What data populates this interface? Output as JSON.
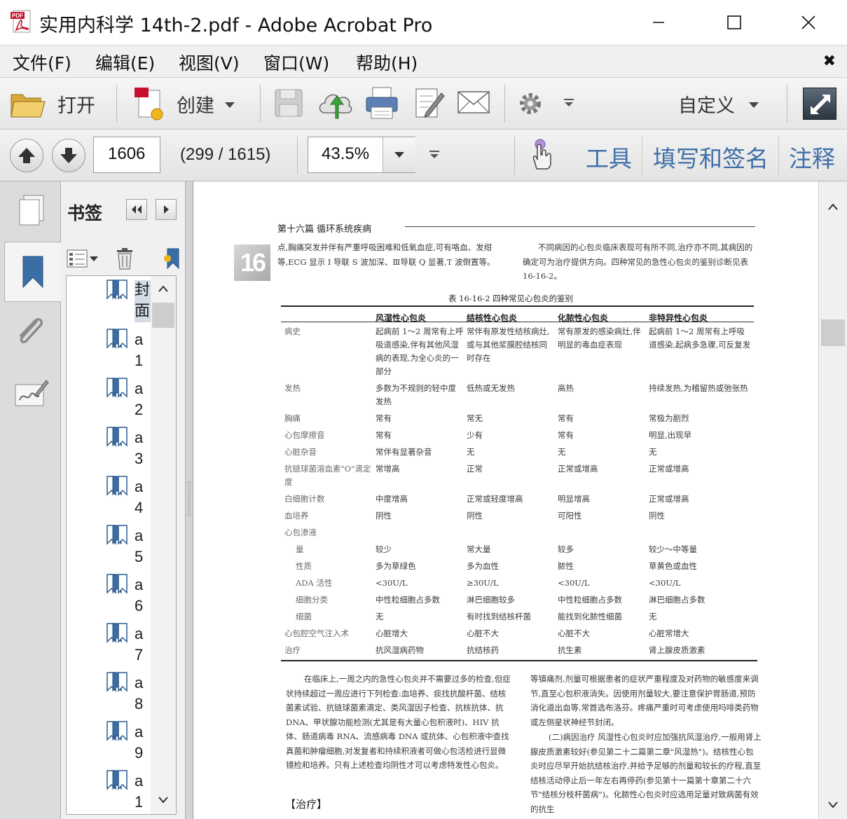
{
  "window": {
    "title": "实用内科学 14th-2.pdf - Adobe Acrobat Pro",
    "app_icon": "pdf-file-icon",
    "controls": [
      "minimize-icon",
      "maximize-icon",
      "close-icon"
    ]
  },
  "menu": {
    "items": [
      "文件(F)",
      "编辑(E)",
      "视图(V)",
      "窗口(W)",
      "帮助(H)"
    ],
    "close_glyph": "✖"
  },
  "toolbar": {
    "open_label": "打开",
    "create_label": "创建",
    "customize_label": "自定义"
  },
  "nav": {
    "page_number": "1606",
    "page_count": "(299 / 1615)",
    "zoom": "43.5%",
    "tabs": [
      "工具",
      "填写和签名",
      "注释"
    ]
  },
  "sidebar": {
    "title": "书签",
    "bookmarks": [
      {
        "label": "封面",
        "selected": true
      },
      {
        "label": "a1",
        "selected": false
      },
      {
        "label": "a2",
        "selected": false
      },
      {
        "label": "a3",
        "selected": false
      },
      {
        "label": "a4",
        "selected": false
      },
      {
        "label": "a5",
        "selected": false
      },
      {
        "label": "a6",
        "selected": false
      },
      {
        "label": "a7",
        "selected": false
      },
      {
        "label": "a8",
        "selected": false
      },
      {
        "label": "a9",
        "selected": false
      },
      {
        "label": "a1",
        "selected": false
      }
    ]
  },
  "document": {
    "header": "第十六篇    循环系统疾病",
    "chapter_badge": "16",
    "intro_left": "点,胸痛突发并伴有严重呼吸困难和低氧血症,可有咯血、发绀等,ECG 显示 I 导联 S 波加深、Ⅲ导联 Q 显著,T 波倒置等。",
    "intro_right": "不同病因的心包炎临床表现可有所不同,治疗亦不同,其病因的确定可为治疗提供方向。四种常见的急性心包炎的鉴别诊断见表 16-16-2。",
    "table_caption": "表 16-16-2    四种常见心包炎的鉴别",
    "table_headers": [
      "",
      "风湿性心包炎",
      "结核性心包炎",
      "化脓性心包炎",
      "非特异性心包炎"
    ],
    "table_rows": [
      {
        "sub": false,
        "cells": [
          "病史",
          "起病前 1～2 周常有上呼吸道感染,伴有其他风湿病的表现,为全心炎的一部分",
          "常伴有原发性结核病灶,或与其他浆膜腔结核同时存在",
          "常有原发的感染病灶,伴明显的毒血症表现",
          "起病前 1～2 周常有上呼吸道感染,起病多急骤,可反复发"
        ]
      },
      {
        "sub": false,
        "cells": [
          "发热",
          "多数为不规则的轻中度发热",
          "低热或无发热",
          "高热",
          "持续发热,为稽留热或弛张热"
        ]
      },
      {
        "sub": false,
        "cells": [
          "胸痛",
          "常有",
          "常无",
          "常有",
          "常极为剧烈"
        ]
      },
      {
        "sub": false,
        "cells": [
          "心包摩擦音",
          "常有",
          "少有",
          "常有",
          "明显,出现早"
        ]
      },
      {
        "sub": false,
        "cells": [
          "心脏杂音",
          "常伴有显著杂音",
          "无",
          "无",
          "无"
        ]
      },
      {
        "sub": false,
        "cells": [
          "抗链球菌溶血素\"O\"滴定度",
          "常增高",
          "正常",
          "正常或增高",
          "正常或增高"
        ]
      },
      {
        "sub": false,
        "cells": [
          "白细胞计数",
          "中度增高",
          "正常或轻度增高",
          "明显增高",
          "正常或增高"
        ]
      },
      {
        "sub": false,
        "cells": [
          "血培养",
          "阴性",
          "阴性",
          "可阳性",
          "阴性"
        ]
      },
      {
        "sub": false,
        "cells": [
          "心包渗液",
          "",
          "",
          "",
          ""
        ]
      },
      {
        "sub": true,
        "cells": [
          "量",
          "较少",
          "常大量",
          "较多",
          "较少～中等量"
        ]
      },
      {
        "sub": true,
        "cells": [
          "性质",
          "多为草绿色",
          "多为血性",
          "脓性",
          "草黄色或血性"
        ]
      },
      {
        "sub": true,
        "cells": [
          "ADA 活性",
          "<30U/L",
          "≥30U/L",
          "<30U/L",
          "<30U/L"
        ]
      },
      {
        "sub": true,
        "cells": [
          "细胞分类",
          "中性粒细胞占多数",
          "淋巴细胞较多",
          "中性粒细胞占多数",
          "淋巴细胞占多数"
        ]
      },
      {
        "sub": true,
        "cells": [
          "细菌",
          "无",
          "有时找到结核杆菌",
          "能找到化脓性细菌",
          "无"
        ]
      },
      {
        "sub": false,
        "cells": [
          "心包腔空气注入术",
          "心脏增大",
          "心脏不大",
          "心脏不大",
          "心脏常增大"
        ]
      },
      {
        "sub": false,
        "cells": [
          "治疗",
          "抗风湿病药物",
          "抗结核药",
          "抗生素",
          "肾上腺皮质激素"
        ]
      }
    ],
    "bottom_left": "在临床上,一周之内的急性心包炎并不需要过多的检查,但症状持续超过一周应进行下列检查:血培养、痰找抗酸杆菌、结核菌素试验、抗链球菌素滴定、类风湿因子检查、抗核抗体、抗 DNA、甲状腺功能检测(尤其是有大量心包积液时)、HIV 抗体、肠道病毒 RNA、流感病毒 DNA 或抗体、心包积液中查找真菌和肿瘤细胞,对发复者和持续积液者可做心包活检进行显微镜检和培养。只有上述检查均阴性才可以考虑特发性心包炎。",
    "bottom_right_1": "等镇痛剂,剂量可根据患者的症状严重程度及对药物的敏感度来调节,直至心包积液消失。因使用剂量较大,要注意保护胃肠道,预防消化道出血等,常首选布洛芬。疼痛严重时可考虑使用吗啡类药物或左侧星状神经节封闭。",
    "bottom_right_2": "(二)病因治疗  风湿性心包炎时应加强抗风湿治疗,一般用肾上腺皮质激素较好(参见第二十二篇第二章\"风湿热\")。结核性心包炎时应尽早开始抗结核治疗,并给予足够的剂量和较长的疗程,直至结核活动停止后一年左右再停药(参见第十一篇第十章第二十六节\"结核分枝杆菌病\")。化脓性心包炎时应选用足量对致病菌有效的抗生",
    "treatment_heading": "【治疗】"
  }
}
